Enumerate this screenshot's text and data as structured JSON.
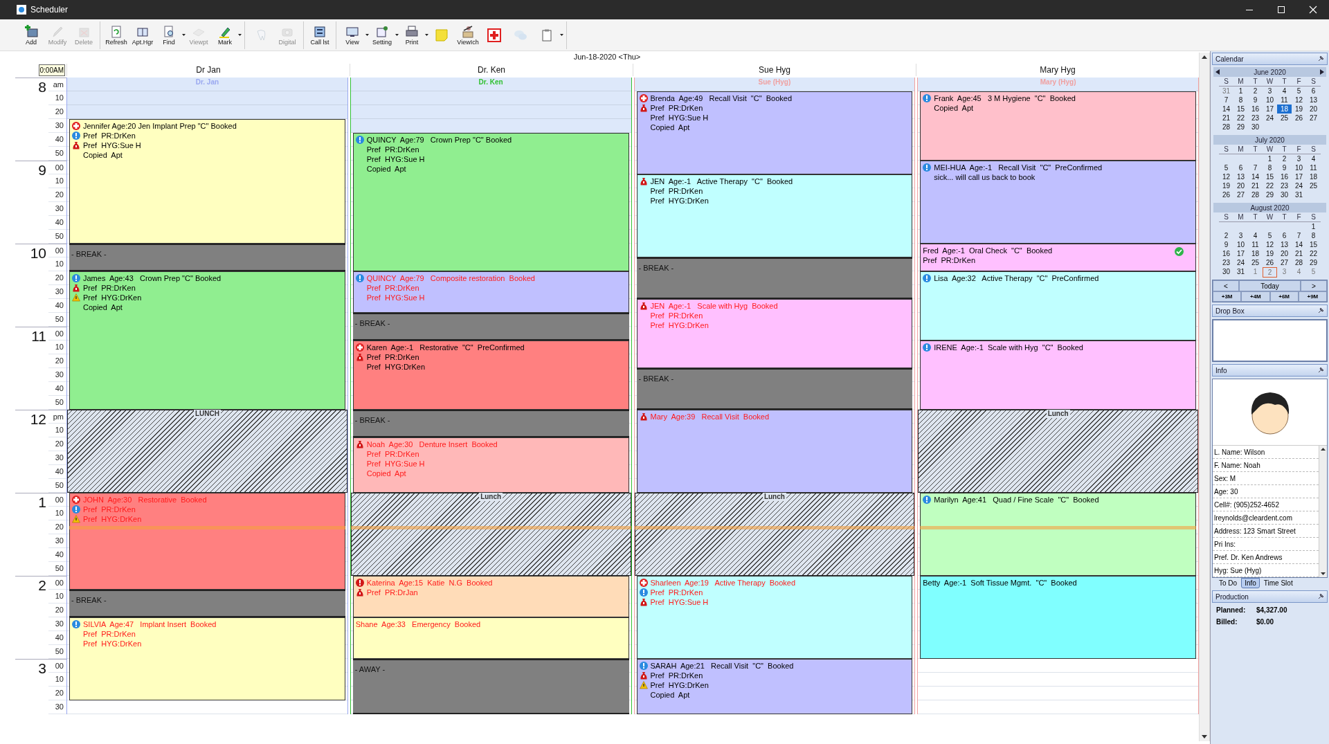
{
  "window": {
    "title": "Scheduler"
  },
  "toolbar": [
    [
      {
        "kind": "add",
        "label": "Add",
        "disabled": false,
        "menu": false
      },
      {
        "kind": "modify",
        "label": "Modify",
        "disabled": true,
        "menu": false
      },
      {
        "kind": "delete",
        "label": "Delete",
        "disabled": true,
        "menu": false
      }
    ],
    [
      {
        "kind": "refresh",
        "label": "Refresh",
        "disabled": false,
        "menu": false
      },
      {
        "kind": "book",
        "label": "Apt.Hgr",
        "disabled": false,
        "menu": false
      },
      {
        "kind": "find",
        "label": "Find",
        "disabled": false,
        "menu": true
      },
      {
        "kind": "viewpt",
        "label": "Viewpt",
        "disabled": true,
        "menu": false
      },
      {
        "kind": "mark",
        "label": "Mark",
        "disabled": false,
        "menu": true
      }
    ],
    [
      {
        "kind": "tooth",
        "disabled": true,
        "menu": false
      },
      {
        "kind": "digital",
        "label": "Digital",
        "disabled": true,
        "menu": false
      }
    ],
    [
      {
        "kind": "calllist",
        "label": "Call lst",
        "disabled": false,
        "menu": false
      }
    ],
    [
      {
        "kind": "view",
        "label": "View",
        "disabled": false,
        "menu": true
      },
      {
        "kind": "setting",
        "label": "Setting",
        "disabled": false,
        "menu": true
      },
      {
        "kind": "print",
        "label": "Print",
        "disabled": false,
        "menu": true
      },
      {
        "kind": "note",
        "disabled": false,
        "menu": false
      },
      {
        "kind": "viewch",
        "label": "ViewIch",
        "disabled": false,
        "menu": false
      },
      {
        "kind": "redplus",
        "disabled": false,
        "menu": false
      },
      {
        "kind": "chat",
        "disabled": true,
        "menu": false
      },
      {
        "kind": "clipboard",
        "disabled": false,
        "menu": true
      }
    ]
  ],
  "schedule": {
    "date": "Jun-18-2020 <Thu>",
    "time_hint": "0:00AM",
    "hours": [
      {
        "label": "8",
        "minutes": [
          "am",
          "10",
          "20",
          "30",
          "40",
          "50"
        ]
      },
      {
        "label": "9",
        "minutes": [
          "00",
          "10",
          "20",
          "30",
          "40",
          "50"
        ]
      },
      {
        "label": "10",
        "minutes": [
          "00",
          "10",
          "20",
          "30",
          "40",
          "50"
        ]
      },
      {
        "label": "11",
        "minutes": [
          "00",
          "10",
          "20",
          "30",
          "40",
          "50"
        ]
      },
      {
        "label": "12",
        "minutes": [
          "pm",
          "10",
          "20",
          "30",
          "40",
          "50"
        ]
      },
      {
        "label": "1",
        "minutes": [
          "00",
          "10",
          "20",
          "30",
          "40",
          "50"
        ]
      },
      {
        "label": "2",
        "minutes": [
          "00",
          "10",
          "20",
          "30",
          "40",
          "50"
        ]
      },
      {
        "label": "3",
        "minutes": [
          "00",
          "10",
          "20",
          "30"
        ]
      }
    ],
    "columns": [
      {
        "title": "Dr Jan",
        "subtitle": "Dr. Jan",
        "color": "#9aa8f0",
        "blocks": [
          {
            "kind": "closed",
            "rows": [
              {
                "kind": "slot"
              },
              {
                "kind": "slot"
              },
              {
                "kind": "slot"
              }
            ]
          },
          {
            "kind": "appointment",
            "color": "#ffffc0",
            "alert": false,
            "icons": [
              {
                "kind": "medical"
              },
              {
                "kind": "info"
              },
              {
                "kind": "money"
              }
            ],
            "lines": [
              "Jennifer Age:20 Jen Implant Prep \"C\" Booked",
              "Pref  PR:DrKen",
              "Pref  HYG:Sue H",
              "Copied  Apt"
            ],
            "rows": [
              {
                "kind": "slot"
              },
              {
                "kind": "slot"
              },
              {
                "kind": "slot"
              },
              {
                "kind": "slot"
              },
              {
                "kind": "slot"
              },
              {
                "kind": "slot"
              },
              {
                "kind": "slot"
              },
              {
                "kind": "slot"
              },
              {
                "kind": "slot"
              }
            ]
          },
          {
            "kind": "break",
            "label": "- BREAK -",
            "rows": [
              {
                "kind": "slot"
              },
              {
                "kind": "slot"
              }
            ]
          },
          {
            "kind": "appointment",
            "color": "#90ee90",
            "alert": false,
            "icons": [
              {
                "kind": "info"
              },
              {
                "kind": "money"
              },
              {
                "kind": "warning"
              }
            ],
            "lines": [
              "James  Age:43   Crown Prep \"C\" Booked",
              "Pref  PR:DrKen",
              "Pref  HYG:DrKen",
              "Copied  Apt"
            ],
            "rows": [
              {
                "kind": "slot"
              },
              {
                "kind": "slot"
              },
              {
                "kind": "slot"
              },
              {
                "kind": "slot"
              },
              {
                "kind": "slot"
              },
              {
                "kind": "slot"
              },
              {
                "kind": "slot"
              },
              {
                "kind": "slot"
              },
              {
                "kind": "slot"
              },
              {
                "kind": "slot"
              }
            ]
          },
          {
            "kind": "lunch",
            "label": "LUNCH",
            "rows": [
              {
                "kind": "slot"
              },
              {
                "kind": "slot"
              },
              {
                "kind": "slot"
              },
              {
                "kind": "slot"
              },
              {
                "kind": "slot"
              },
              {
                "kind": "slot"
              }
            ]
          },
          {
            "kind": "appointment",
            "color": "#ff8080",
            "alert": true,
            "icons": [
              {
                "kind": "medical"
              },
              {
                "kind": "info"
              },
              {
                "kind": "warning"
              }
            ],
            "lines": [
              "JOHN  Age:30   Restorative  Booked",
              "Pref  PR:DrKen",
              "Pref  HYG:DrKen"
            ],
            "rows": [
              {
                "kind": "slot"
              },
              {
                "kind": "slot"
              },
              {
                "kind": "slot",
                "now": true
              },
              {
                "kind": "slot"
              },
              {
                "kind": "slot"
              },
              {
                "kind": "slot"
              },
              {
                "kind": "slot"
              }
            ]
          },
          {
            "kind": "break",
            "label": "- BREAK -",
            "rows": [
              {
                "kind": "slot"
              },
              {
                "kind": "slot"
              }
            ]
          },
          {
            "kind": "appointment",
            "color": "#ffffc0",
            "alert": true,
            "icons": [
              {
                "kind": "info"
              }
            ],
            "lines": [
              "SILVIA  Age:47   Implant Insert  Booked",
              "Pref  PR:DrKen",
              "Pref  HYG:DrKen"
            ],
            "rows": [
              {
                "kind": "slot"
              },
              {
                "kind": "slot"
              },
              {
                "kind": "slot"
              },
              {
                "kind": "slot"
              },
              {
                "kind": "slot"
              },
              {
                "kind": "slot"
              }
            ]
          },
          {
            "kind": "open",
            "rows": [
              {
                "kind": "slot"
              }
            ]
          }
        ]
      },
      {
        "title": "Dr. Ken",
        "subtitle": "Dr. Ken",
        "color": "#30c030",
        "blocks": [
          {
            "kind": "closed",
            "rows": [
              {
                "kind": "slot"
              },
              {
                "kind": "slot"
              },
              {
                "kind": "slot"
              },
              {
                "kind": "slot"
              }
            ]
          },
          {
            "kind": "appointment",
            "color": "#90ee90",
            "alert": false,
            "icons": [
              {
                "kind": "info"
              }
            ],
            "lines": [
              "QUINCY  Age:79   Crown Prep \"C\" Booked",
              "Pref  PR:DrKen",
              "Pref  HYG:Sue H",
              "Copied  Apt"
            ],
            "rows": [
              {
                "kind": "slot"
              },
              {
                "kind": "slot"
              },
              {
                "kind": "slot"
              },
              {
                "kind": "slot"
              },
              {
                "kind": "slot"
              },
              {
                "kind": "slot"
              },
              {
                "kind": "slot"
              },
              {
                "kind": "slot"
              },
              {
                "kind": "slot"
              },
              {
                "kind": "slot"
              }
            ]
          },
          {
            "kind": "appointment",
            "color": "#c0c0ff",
            "alert": true,
            "icons": [
              {
                "kind": "info"
              }
            ],
            "lines": [
              "QUINCY  Age:79   Composite restoration  Booked",
              "Pref  PR:DrKen",
              "Pref  HYG:Sue H"
            ],
            "rows": [
              {
                "kind": "slot"
              },
              {
                "kind": "slot"
              },
              {
                "kind": "slot"
              }
            ]
          },
          {
            "kind": "break",
            "label": "- BREAK -",
            "rows": [
              {
                "kind": "slot"
              },
              {
                "kind": "slot"
              }
            ]
          },
          {
            "kind": "appointment",
            "color": "#ff8080",
            "alert": false,
            "icons": [
              {
                "kind": "medical"
              },
              {
                "kind": "money"
              }
            ],
            "lines": [
              "Karen  Age:-1   Restorative  \"C\"  PreConfirmed",
              "Pref  PR:DrKen",
              "Pref  HYG:DrKen"
            ],
            "rows": [
              {
                "kind": "slot"
              },
              {
                "kind": "slot"
              },
              {
                "kind": "slot"
              },
              {
                "kind": "slot"
              },
              {
                "kind": "slot"
              }
            ]
          },
          {
            "kind": "break",
            "label": "- BREAK -",
            "rows": [
              {
                "kind": "slot"
              },
              {
                "kind": "slot"
              }
            ]
          },
          {
            "kind": "appointment",
            "color": "#ffb8b8",
            "alert": true,
            "icons": [
              {
                "kind": "money"
              }
            ],
            "lines": [
              "Noah  Age:30   Denture Insert  Booked",
              "Pref  PR:DrKen",
              "Pref  HYG:Sue H",
              "Copied  Apt"
            ],
            "rows": [
              {
                "kind": "slot"
              },
              {
                "kind": "slot"
              },
              {
                "kind": "slot"
              },
              {
                "kind": "slot"
              }
            ]
          },
          {
            "kind": "lunch",
            "label": "Lunch",
            "rows": [
              {
                "kind": "slot"
              },
              {
                "kind": "slot"
              },
              {
                "kind": "slot",
                "now": true
              },
              {
                "kind": "slot"
              },
              {
                "kind": "slot"
              },
              {
                "kind": "slot"
              }
            ]
          },
          {
            "kind": "appointment",
            "color": "#ffdcb8",
            "alert": true,
            "icons": [
              {
                "kind": "alert"
              },
              {
                "kind": "money"
              }
            ],
            "lines": [
              "Katerina  Age:15  Katie  N.G  Booked",
              "Pref  PR:DrJan"
            ],
            "rows": [
              {
                "kind": "slot"
              },
              {
                "kind": "slot"
              },
              {
                "kind": "slot"
              }
            ]
          },
          {
            "kind": "appointment",
            "color": "#ffffc0",
            "alert": true,
            "lines": [
              "Shane  Age:33   Emergency  Booked"
            ],
            "rows": [
              {
                "kind": "slot"
              },
              {
                "kind": "slot"
              },
              {
                "kind": "slot"
              }
            ]
          },
          {
            "kind": "away",
            "label": "- AWAY -",
            "rows": [
              {
                "kind": "slot"
              },
              {
                "kind": "slot"
              },
              {
                "kind": "slot"
              },
              {
                "kind": "slot"
              }
            ]
          }
        ]
      },
      {
        "title": "Sue Hyg",
        "subtitle": "Sue (Hyg)",
        "color": "#f0a0a0",
        "blocks": [
          {
            "kind": "closed",
            "rows": [
              {
                "kind": "slot"
              }
            ]
          },
          {
            "kind": "appointment",
            "color": "#c0c0ff",
            "alert": false,
            "icons": [
              {
                "kind": "medical"
              },
              {
                "kind": "money"
              }
            ],
            "lines": [
              "Brenda  Age:49   Recall Visit  \"C\"  Booked",
              "Pref  PR:DrKen",
              "Pref  HYG:Sue H",
              "Copied  Apt"
            ],
            "rows": [
              {
                "kind": "slot"
              },
              {
                "kind": "slot"
              },
              {
                "kind": "slot"
              },
              {
                "kind": "slot"
              },
              {
                "kind": "slot"
              },
              {
                "kind": "slot"
              }
            ]
          },
          {
            "kind": "appointment",
            "color": "#c0ffff",
            "alert": false,
            "icons": [
              {
                "kind": "money"
              }
            ],
            "lines": [
              "JEN  Age:-1   Active Therapy  \"C\"  Booked",
              "Pref  PR:DrKen",
              "Pref  HYG:DrKen"
            ],
            "rows": [
              {
                "kind": "slot"
              },
              {
                "kind": "slot"
              },
              {
                "kind": "slot"
              },
              {
                "kind": "slot"
              },
              {
                "kind": "slot"
              },
              {
                "kind": "slot"
              }
            ]
          },
          {
            "kind": "break",
            "label": "- BREAK -",
            "rows": [
              {
                "kind": "slot"
              },
              {
                "kind": "slot"
              },
              {
                "kind": "slot"
              }
            ]
          },
          {
            "kind": "appointment",
            "color": "#ffc0ff",
            "alert": true,
            "icons": [
              {
                "kind": "money"
              }
            ],
            "lines": [
              "JEN  Age:-1   Scale with Hyg  Booked",
              "Pref  PR:DrKen",
              "Pref  HYG:DrKen"
            ],
            "rows": [
              {
                "kind": "slot"
              },
              {
                "kind": "slot"
              },
              {
                "kind": "slot"
              },
              {
                "kind": "slot"
              },
              {
                "kind": "slot"
              }
            ]
          },
          {
            "kind": "break",
            "label": "- BREAK -",
            "rows": [
              {
                "kind": "slot"
              },
              {
                "kind": "slot"
              },
              {
                "kind": "slot"
              }
            ]
          },
          {
            "kind": "appointment",
            "color": "#c0c0ff",
            "alert": true,
            "icons": [
              {
                "kind": "money"
              }
            ],
            "lines": [
              "Mary  Age:39   Recall Visit  Booked"
            ],
            "rows": [
              {
                "kind": "slot"
              },
              {
                "kind": "slot"
              },
              {
                "kind": "slot"
              },
              {
                "kind": "slot"
              },
              {
                "kind": "slot"
              },
              {
                "kind": "slot"
              }
            ]
          },
          {
            "kind": "lunch",
            "label": "Lunch",
            "rows": [
              {
                "kind": "slot"
              },
              {
                "kind": "slot"
              },
              {
                "kind": "slot",
                "now": true
              },
              {
                "kind": "slot"
              },
              {
                "kind": "slot"
              },
              {
                "kind": "slot"
              }
            ]
          },
          {
            "kind": "appointment",
            "color": "#c0ffff",
            "alert": true,
            "icons": [
              {
                "kind": "medical"
              },
              {
                "kind": "info"
              },
              {
                "kind": "money"
              }
            ],
            "lines": [
              "Sharleen  Age:19   Active Therapy  Booked",
              "Pref  PR:DrKen",
              "Pref  HYG:Sue H"
            ],
            "rows": [
              {
                "kind": "slot"
              },
              {
                "kind": "slot"
              },
              {
                "kind": "slot"
              },
              {
                "kind": "slot"
              },
              {
                "kind": "slot"
              },
              {
                "kind": "slot"
              }
            ]
          },
          {
            "kind": "appointment",
            "color": "#c0c0ff",
            "alert": false,
            "icons": [
              {
                "kind": "info"
              },
              {
                "kind": "money"
              },
              {
                "kind": "warning"
              }
            ],
            "lines": [
              "SARAH  Age:21   Recall Visit  \"C\"  Booked",
              "Pref  PR:DrKen",
              "Pref  HYG:DrKen",
              "Copied  Apt"
            ],
            "rows": [
              {
                "kind": "slot"
              },
              {
                "kind": "slot"
              },
              {
                "kind": "slot"
              },
              {
                "kind": "slot"
              }
            ]
          }
        ]
      },
      {
        "title": "Mary Hyg",
        "subtitle": "Mary (Hyg)",
        "color": "#f0a0a0",
        "blocks": [
          {
            "kind": "closed",
            "rows": [
              {
                "kind": "slot"
              }
            ]
          },
          {
            "kind": "appointment",
            "color": "#ffc0cb",
            "alert": false,
            "icons": [
              {
                "kind": "info"
              }
            ],
            "lines": [
              "Frank  Age:45   3 M Hygiene  \"C\"  Booked",
              "Copied  Apt"
            ],
            "rows": [
              {
                "kind": "slot"
              },
              {
                "kind": "slot"
              },
              {
                "kind": "slot"
              },
              {
                "kind": "slot"
              },
              {
                "kind": "slot"
              }
            ]
          },
          {
            "kind": "appointment",
            "color": "#c0c0ff",
            "alert": false,
            "icons": [
              {
                "kind": "info"
              }
            ],
            "lines": [
              "MEI-HUA  Age:-1   Recall Visit  \"C\"  PreConfirmed",
              "sick... will call us back to book"
            ],
            "rows": [
              {
                "kind": "slot"
              },
              {
                "kind": "slot"
              },
              {
                "kind": "slot"
              },
              {
                "kind": "slot"
              },
              {
                "kind": "slot"
              },
              {
                "kind": "slot"
              }
            ]
          },
          {
            "kind": "appointment",
            "color": "#ffc0ff",
            "alert": false,
            "icons": [
              {
                "kind": "check"
              }
            ],
            "lines": [
              "Fred  Age:-1  Oral Check  \"C\"  Booked",
              "Pref  PR:DrKen"
            ],
            "rows": [
              {
                "kind": "slot"
              },
              {
                "kind": "slot"
              }
            ]
          },
          {
            "kind": "appointment",
            "color": "#c0ffff",
            "alert": false,
            "icons": [
              {
                "kind": "info"
              }
            ],
            "lines": [
              "Lisa  Age:32   Active Therapy  \"C\"  PreConfirmed"
            ],
            "rows": [
              {
                "kind": "slot"
              },
              {
                "kind": "slot"
              },
              {
                "kind": "slot"
              },
              {
                "kind": "slot"
              },
              {
                "kind": "slot"
              }
            ]
          },
          {
            "kind": "appointment",
            "color": "#ffc0ff",
            "alert": false,
            "icons": [
              {
                "kind": "info"
              }
            ],
            "lines": [
              "IRENE  Age:-1  Scale with Hyg  \"C\"  Booked"
            ],
            "rows": [
              {
                "kind": "slot"
              },
              {
                "kind": "slot"
              },
              {
                "kind": "slot"
              },
              {
                "kind": "slot"
              },
              {
                "kind": "slot"
              }
            ]
          },
          {
            "kind": "lunch",
            "label": "Lunch",
            "rows": [
              {
                "kind": "slot"
              },
              {
                "kind": "slot"
              },
              {
                "kind": "slot"
              },
              {
                "kind": "slot"
              },
              {
                "kind": "slot"
              },
              {
                "kind": "slot"
              }
            ]
          },
          {
            "kind": "appointment",
            "color": "#c0ffc0",
            "alert": false,
            "icons": [
              {
                "kind": "info"
              }
            ],
            "lines": [
              "Marilyn  Age:41   Quad / Fine Scale  \"C\"  Booked"
            ],
            "rows": [
              {
                "kind": "slot"
              },
              {
                "kind": "slot"
              },
              {
                "kind": "slot",
                "now": true
              },
              {
                "kind": "slot"
              },
              {
                "kind": "slot"
              },
              {
                "kind": "slot"
              }
            ]
          },
          {
            "kind": "appointment",
            "color": "#80ffff",
            "alert": false,
            "lines": [
              "Betty  Age:-1  Soft Tissue Mgmt.  \"C\"  Booked"
            ],
            "rows": [
              {
                "kind": "slot"
              },
              {
                "kind": "slot"
              },
              {
                "kind": "slot"
              },
              {
                "kind": "slot"
              },
              {
                "kind": "slot"
              },
              {
                "kind": "slot"
              }
            ]
          },
          {
            "kind": "open",
            "rows": [
              {
                "kind": "slot"
              },
              {
                "kind": "slot"
              },
              {
                "kind": "slot"
              },
              {
                "kind": "slot"
              }
            ]
          }
        ]
      }
    ]
  },
  "sidebar": {
    "calendar": {
      "title": "Calendar",
      "nav": [
        "<",
        "Today",
        ">"
      ],
      "jumps": [
        "+3M",
        "+4M",
        "+6M",
        "+9M"
      ],
      "months": [
        {
          "title": "June 2020",
          "arrows": true,
          "weekdays": [
            "S",
            "M",
            "T",
            "W",
            "T",
            "F",
            "S"
          ],
          "weeks": [
            [
              {
                "day": "31",
                "outside": true,
                "selected": false
              },
              "1",
              "2",
              "3",
              "4",
              "5",
              "6"
            ],
            [
              "7",
              "8",
              "9",
              "10",
              "11",
              "12",
              "13"
            ],
            [
              "14",
              "15",
              "16",
              "17",
              {
                "day": "18",
                "selected": true
              },
              "19",
              "20"
            ],
            [
              "21",
              "22",
              "23",
              "24",
              "25",
              "26",
              "27"
            ],
            [
              "28",
              "29",
              "30"
            ]
          ]
        },
        {
          "title": "July 2020",
          "arrows": false,
          "weekdays": [
            "S",
            "M",
            "T",
            "W",
            "T",
            "F",
            "S"
          ],
          "weeks": [
            [
              "1",
              "2",
              "3",
              "4"
            ],
            [
              "5",
              "6",
              "7",
              "8",
              "9",
              "10",
              "11"
            ],
            [
              "12",
              "13",
              "14",
              "15",
              "16",
              "17",
              "18"
            ],
            [
              "19",
              "20",
              "21",
              "22",
              "23",
              "24",
              "25"
            ],
            [
              "26",
              "27",
              "28",
              "29",
              "30",
              "31"
            ]
          ]
        },
        {
          "title": "August 2020",
          "arrows": false,
          "weekdays": [
            "S",
            "M",
            "T",
            "W",
            "T",
            "F",
            "S"
          ],
          "weeks": [
            [
              "1"
            ],
            [
              "2",
              "3",
              "4",
              "5",
              "6",
              "7",
              "8"
            ],
            [
              "9",
              "10",
              "11",
              "12",
              "13",
              "14",
              "15"
            ],
            [
              "16",
              "17",
              "18",
              "19",
              "20",
              "21",
              "22"
            ],
            [
              "23",
              "24",
              "25",
              "26",
              "27",
              "28",
              "29"
            ],
            [
              "30",
              "31",
              {
                "day": "1",
                "outside": true,
                "selected": false
              },
              {
                "day": "2",
                "outside": true,
                "selected": false,
                "today": true
              },
              {
                "day": "3",
                "outside": true,
                "selected": false
              },
              {
                "day": "4",
                "outside": true,
                "selected": false
              },
              {
                "day": "5",
                "outside": true,
                "selected": false
              }
            ]
          ]
        }
      ]
    },
    "drop_box": {
      "title": "Drop Box"
    },
    "info": {
      "title": "Info",
      "fields": [
        "L. Name: Wilson",
        "F. Name: Noah",
        "Sex: M",
        "Age: 30",
        "Cell#: (905)252-4652",
        "lreynolds@cleardent.com",
        "Address: 123 Smart Street",
        "Pri Ins:",
        "Pref.  Dr. Ken Andrews",
        "Hyg: Sue (Hyg)"
      ],
      "tabs": [
        {
          "label": "To Do",
          "selected": false
        },
        {
          "label": "Info",
          "selected": true
        },
        {
          "label": "Time Slot",
          "selected": false
        }
      ]
    },
    "production": {
      "title": "Production",
      "rows": [
        {
          "label": "Planned:",
          "value": "$4,327.00"
        },
        {
          "label": "Billed:",
          "value": "$0.00"
        }
      ]
    }
  }
}
